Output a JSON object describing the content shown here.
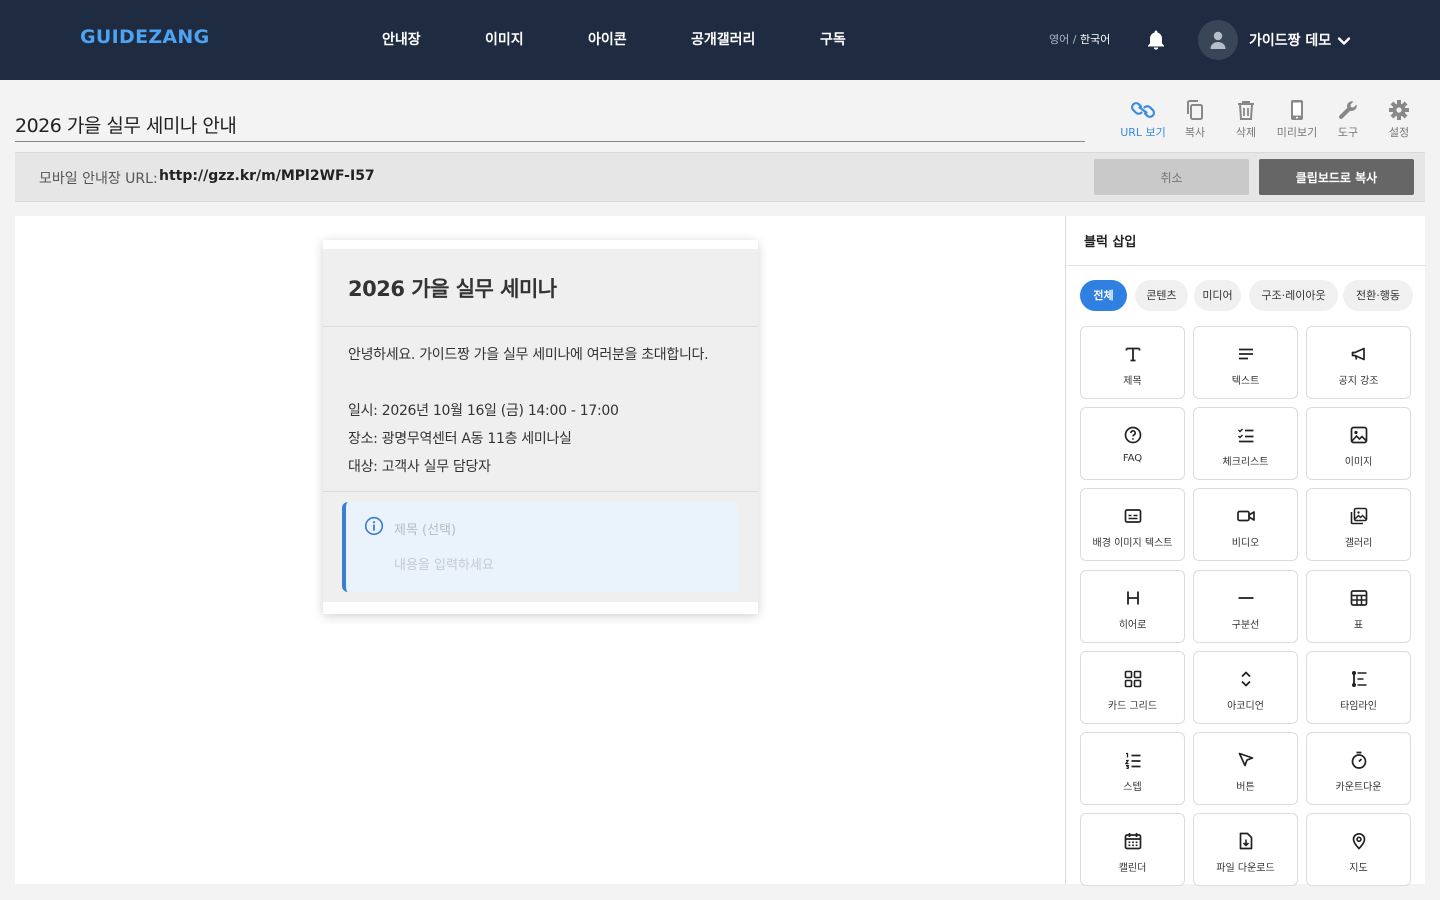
{
  "header": {
    "logo": "GUIDEZANG",
    "nav": [
      "안내장",
      "이미지",
      "아이콘",
      "공개갤러리",
      "구독"
    ],
    "lang_inactive": "영어",
    "lang_sep": " / ",
    "lang_active": "한국어",
    "user_name": "가이드짱 데모"
  },
  "document": {
    "title": "2026 가을 실무 세미나 안내"
  },
  "toolbar": {
    "items": [
      "URL 보기",
      "복사",
      "삭제",
      "미리보기",
      "도구",
      "설정"
    ],
    "active": "URL 보기"
  },
  "url_bar": {
    "label": "모바일 안내장 URL:",
    "url": "http://gzz.kr/m/MPl2WF-I57",
    "cancel_label": "취소",
    "copy_label": "클립보드로 복사"
  },
  "card": {
    "title": "2026 가을 실무 세미나",
    "intro": "안녕하세요. 가이드짱 가을 실무 세미나에 여러분을 초대합니다.",
    "date_line": "일시: 2026년 10월 16일 (금) 14:00 - 17:00",
    "place_line": "장소: 광명무역센터 A동 11층 세미나실",
    "target_line": "대상: 고객사 실무 담당자",
    "callout_title_placeholder": "제목 (선택)",
    "callout_body_placeholder": "내용을 입력하세요"
  },
  "panel": {
    "title": "블럭 삽입",
    "tabs": [
      "전체",
      "콘텐츠",
      "미디어",
      "구조·레이아웃",
      "전환·행동"
    ],
    "active_tab": "전체",
    "blocks": [
      {
        "label": "제목",
        "icon": "heading-icon"
      },
      {
        "label": "텍스트",
        "icon": "text-lines-icon"
      },
      {
        "label": "공지 강조",
        "icon": "megaphone-icon"
      },
      {
        "label": "FAQ",
        "icon": "question-circle-icon"
      },
      {
        "label": "체크리스트",
        "icon": "checklist-icon"
      },
      {
        "label": "이미지",
        "icon": "image-icon"
      },
      {
        "label": "배경 이미지 텍스트",
        "icon": "caption-card-icon"
      },
      {
        "label": "비디오",
        "icon": "video-camera-icon"
      },
      {
        "label": "갤러리",
        "icon": "gallery-icon"
      },
      {
        "label": "히어로",
        "icon": "hero-h-icon"
      },
      {
        "label": "구분선",
        "icon": "divider-line-icon"
      },
      {
        "label": "표",
        "icon": "table-icon"
      },
      {
        "label": "카드 그리드",
        "icon": "card-grid-icon"
      },
      {
        "label": "아코디언",
        "icon": "accordion-chevrons-icon"
      },
      {
        "label": "타임라인",
        "icon": "timeline-icon"
      },
      {
        "label": "스텝",
        "icon": "numbered-list-icon"
      },
      {
        "label": "버튼",
        "icon": "cursor-pointer-icon"
      },
      {
        "label": "카운트다운",
        "icon": "stopwatch-icon"
      },
      {
        "label": "캘린더",
        "icon": "calendar-icon"
      },
      {
        "label": "파일 다운로드",
        "icon": "file-download-icon"
      },
      {
        "label": "지도",
        "icon": "map-pin-icon"
      }
    ]
  },
  "colors": {
    "header_bg": "#1e2b40",
    "logo": "#4da3f2",
    "accent": "#2f80e0",
    "callout_border": "#3a7fd0"
  }
}
